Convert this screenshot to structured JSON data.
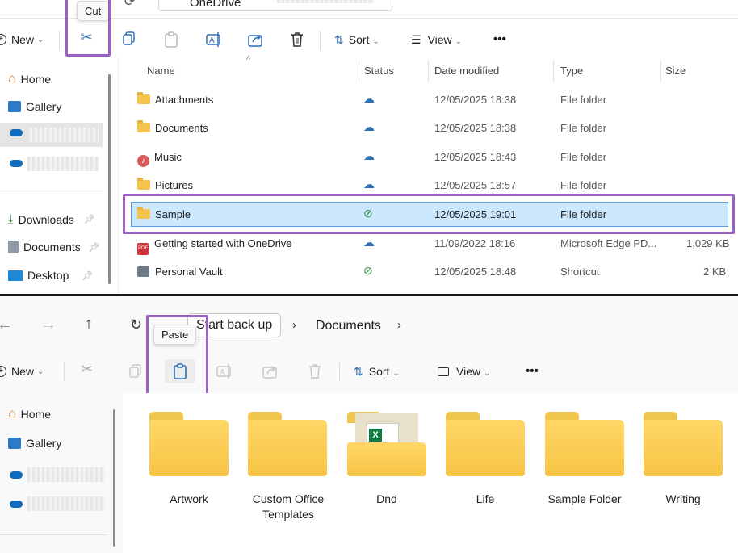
{
  "top_window": {
    "address": {
      "location": "OneDrive"
    },
    "tooltip": "Cut",
    "toolbar": {
      "new_label": "New",
      "sort_label": "Sort",
      "view_label": "View",
      "more": "•••"
    },
    "sidebar": [
      {
        "label": "Home",
        "icon": "home-icon"
      },
      {
        "label": "Gallery",
        "icon": "gallery-icon"
      },
      {
        "label": "",
        "icon": "onedrive-icon"
      },
      {
        "label": "",
        "icon": "onedrive-icon"
      },
      {
        "label": "Downloads",
        "icon": "download-icon",
        "pinned": true
      },
      {
        "label": "Documents",
        "icon": "documents-icon",
        "pinned": true
      },
      {
        "label": "Desktop",
        "icon": "desktop-icon",
        "pinned": true
      }
    ],
    "columns": {
      "name": "Name",
      "status": "Status",
      "date": "Date modified",
      "type": "Type",
      "size": "Size"
    },
    "rows": [
      {
        "name": "Attachments",
        "status": "cloud",
        "date": "12/05/2025 18:38",
        "type": "File folder",
        "size": "",
        "icon": "folder-icon"
      },
      {
        "name": "Documents",
        "status": "cloud",
        "date": "12/05/2025 18:38",
        "type": "File folder",
        "size": "",
        "icon": "folder-icon"
      },
      {
        "name": "Music",
        "status": "cloud",
        "date": "12/05/2025 18:43",
        "type": "File folder",
        "size": "",
        "icon": "music-folder-icon"
      },
      {
        "name": "Pictures",
        "status": "cloud",
        "date": "12/05/2025 18:57",
        "type": "File folder",
        "size": "",
        "icon": "folder-icon"
      },
      {
        "name": "Sample",
        "status": "synced",
        "date": "12/05/2025 19:01",
        "type": "File folder",
        "size": "",
        "icon": "folder-icon",
        "selected": true
      },
      {
        "name": "Getting started with OneDrive",
        "status": "cloud",
        "date": "11/09/2022 18:16",
        "type": "Microsoft Edge PD...",
        "size": "1,029 KB",
        "icon": "pdf-icon"
      },
      {
        "name": "Personal Vault",
        "status": "synced",
        "date": "12/05/2025 18:48",
        "type": "Shortcut",
        "size": "2 KB",
        "icon": "vault-shortcut-icon"
      }
    ]
  },
  "bottom_window": {
    "breadcrumb": {
      "root": "Start back up",
      "current": "Documents"
    },
    "tooltip": "Paste",
    "toolbar": {
      "new_label": "New",
      "sort_label": "Sort",
      "view_label": "View",
      "more": "•••"
    },
    "sidebar": [
      {
        "label": "Home",
        "icon": "home-icon"
      },
      {
        "label": "Gallery",
        "icon": "gallery-icon"
      },
      {
        "label": "",
        "icon": "onedrive-icon"
      },
      {
        "label": "",
        "icon": "onedrive-icon"
      }
    ],
    "folders": [
      {
        "label": "Artwork"
      },
      {
        "label": "Custom Office Templates"
      },
      {
        "label": "Dnd"
      },
      {
        "label": "Life"
      },
      {
        "label": "Sample Folder"
      },
      {
        "label": "Writing"
      }
    ]
  },
  "colors": {
    "highlight": "#9b5fc7",
    "selection": "#cce8ff",
    "folder": "#f6c445",
    "onedrive": "#0f6cbd"
  }
}
